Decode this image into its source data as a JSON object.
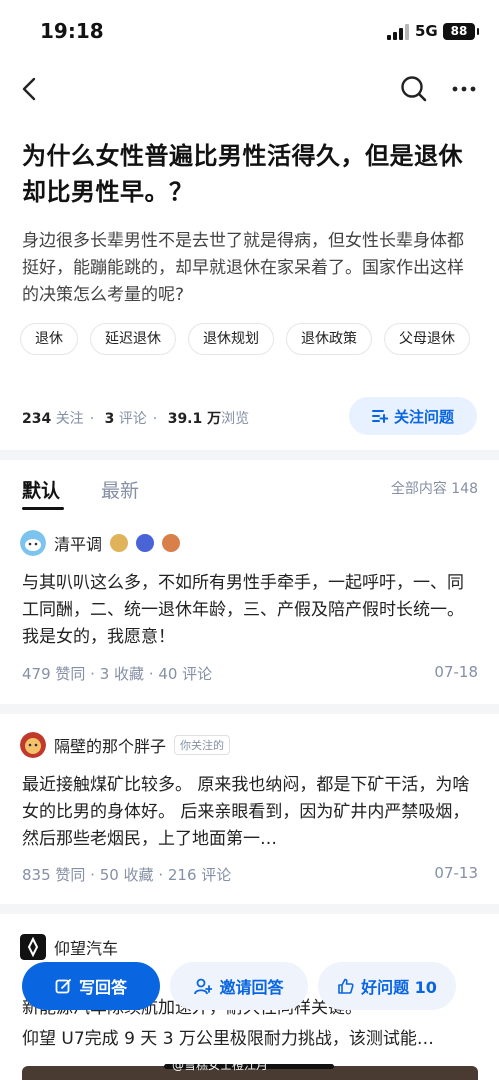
{
  "status": {
    "time": "19:18",
    "network": "5G",
    "battery": "88"
  },
  "nav": {
    "back_icon": "chevron-left-icon",
    "search_icon": "search-icon",
    "more_icon": "more-dots-icon"
  },
  "question": {
    "title": "为什么女性普遍比男性活得久，但是退休却比男性早。？",
    "description": "身边很多长辈男性不是去世了就是得病，但女性长辈身体都挺好，能蹦能跳的，却早就退休在家呆着了。国家作出这样的决策怎么考量的呢?",
    "tags": [
      "退休",
      "延迟退休",
      "退休规划",
      "退休政策",
      "父母退休"
    ],
    "followers_count": "234",
    "followers_label": "关注",
    "comments_count": "3",
    "comments_label": "评论",
    "views_count": "39.1 万",
    "views_label": "浏览",
    "follow_button": "关注问题"
  },
  "answers_header": {
    "tabs": [
      "默认",
      "最新"
    ],
    "total_label": "全部内容 148"
  },
  "answers": [
    {
      "author": "清平调",
      "text": "与其叭叭这么多，不如所有男性手牵手，一起呼吁，一、同工同酬，二、统一退休年龄，三、产假及陪产假时长统一。 我是女的，我愿意！",
      "meta": "479 赞同 · 3 收藏 · 40 评论",
      "date": "07-18"
    },
    {
      "author": "隔壁的那个胖子",
      "followed_tag": "你关注的",
      "text": "最近接触煤矿比较多。 原来我也纳闷，都是下矿干活，为啥女的比男的身体好。 后来亲眼看到，因为矿井内严禁吸烟，然后那些老烟民，上了地面第一…",
      "meta": "835 赞同 · 50 收藏 · 216 评论",
      "date": "07-13"
    },
    {
      "author": "仰望汽车",
      "text_line1": "新能源汽车除续航加速外，耐久性同样关键。",
      "text_line2": "仰望 U7完成 9 天 3 万公里极限耐力挑战，该测试能…"
    }
  ],
  "bottom_bar": {
    "write": "写回答",
    "invite": "邀请回答",
    "good_question": "好问题 10"
  },
  "watermark": "@雪糕女士橙江月",
  "colors": {
    "accent": "#0a66e0",
    "accent_soft": "#e8f1ff",
    "muted": "#8590a6"
  }
}
